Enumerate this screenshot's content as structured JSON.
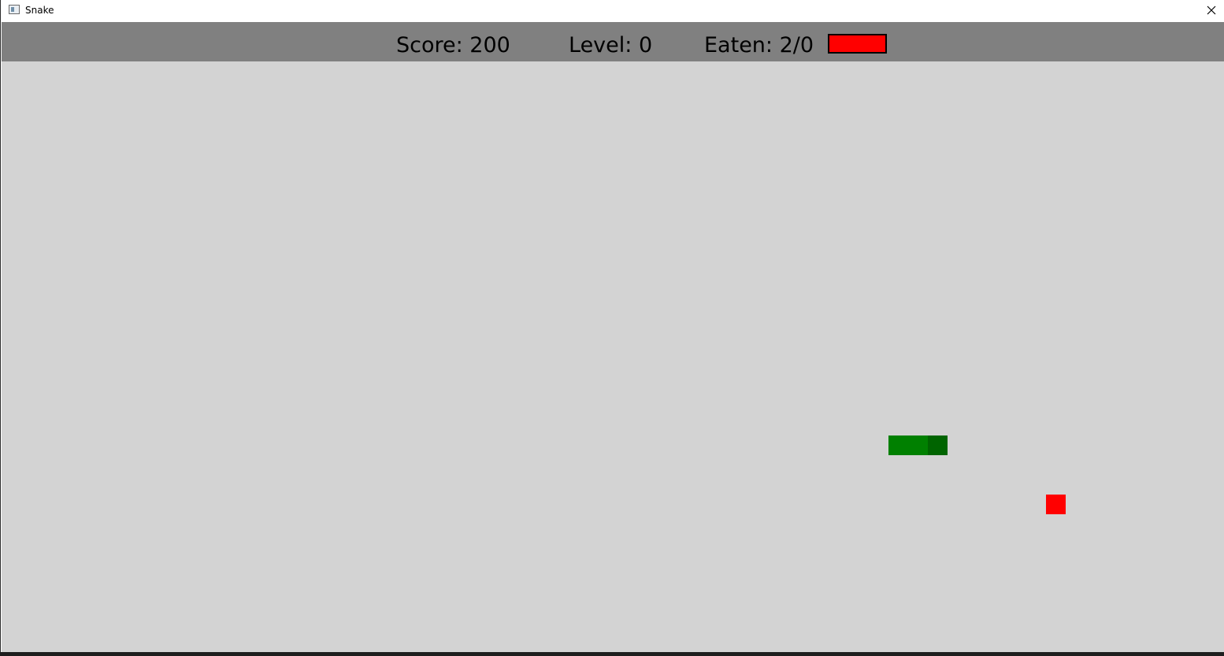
{
  "window": {
    "title": "Snake",
    "close_icon": "close-icon"
  },
  "hud": {
    "score_text": "Score: 200",
    "level_text": "Level: 0",
    "eaten_text": "Eaten: 2/0",
    "indicator_color": "#ff0000"
  },
  "game": {
    "field_color": "#d3d3d3",
    "hud_color": "#808080",
    "snake_color": "#008000",
    "snake_head_color": "#006400",
    "food_color": "#ff0000"
  }
}
